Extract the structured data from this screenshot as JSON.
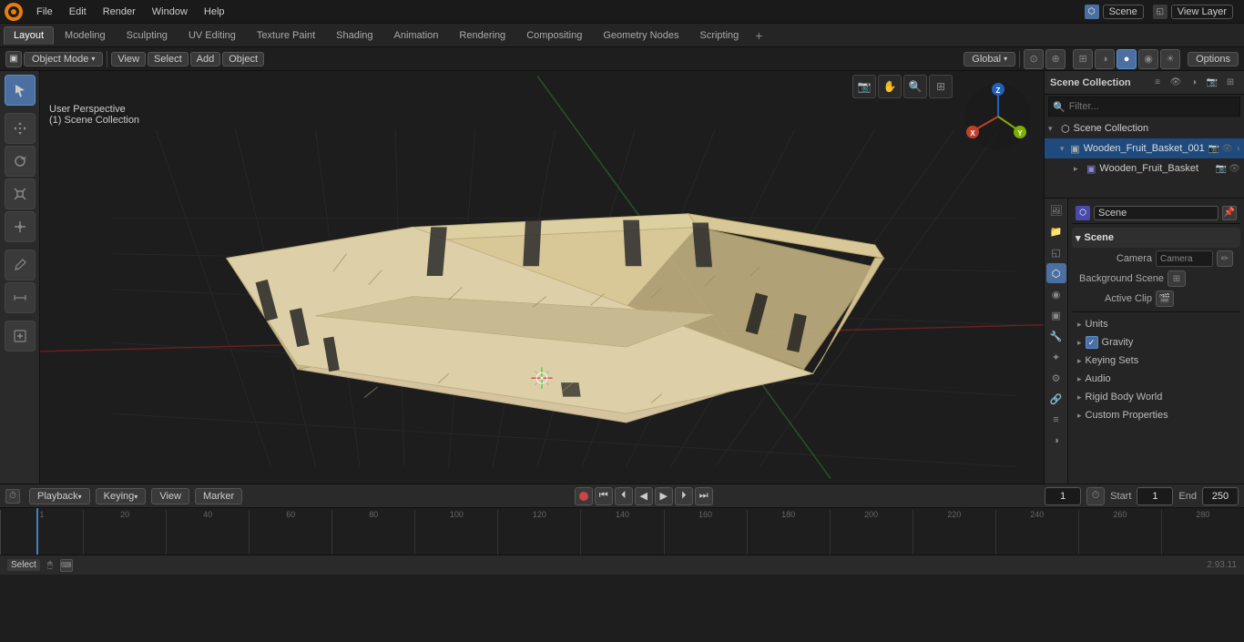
{
  "app": {
    "title": "Blender",
    "version": "2.93.11"
  },
  "top_menu": {
    "items": [
      "File",
      "Edit",
      "Render",
      "Window",
      "Help"
    ]
  },
  "workspace_tabs": {
    "active": "Layout",
    "items": [
      "Layout",
      "Modeling",
      "Sculpting",
      "UV Editing",
      "Texture Paint",
      "Shading",
      "Animation",
      "Rendering",
      "Compositing",
      "Geometry Nodes",
      "Scripting"
    ]
  },
  "header_bar": {
    "mode": "Object Mode",
    "viewport_shading": "Global",
    "options_label": "Options"
  },
  "viewport": {
    "info_line1": "User Perspective",
    "info_line2": "(1) Scene Collection",
    "view_label": "View",
    "select_label": "Select",
    "add_label": "Add",
    "object_label": "Object"
  },
  "outliner": {
    "title": "Scene Collection",
    "search_placeholder": "Filter...",
    "items": [
      {
        "name": "Scene Collection",
        "expanded": true,
        "level": 0,
        "icon": "scene"
      },
      {
        "name": "Wooden_Fruit_Basket_001",
        "expanded": true,
        "level": 1,
        "icon": "mesh",
        "selected": true
      },
      {
        "name": "Wooden_Fruit_Basket",
        "expanded": false,
        "level": 2,
        "icon": "mesh"
      }
    ]
  },
  "properties": {
    "scene_name": "Scene",
    "sections": {
      "scene_header": "Scene",
      "camera_label": "Camera",
      "background_scene_label": "Background Scene",
      "active_clip_label": "Active Clip",
      "units_label": "Units",
      "gravity_label": "Gravity",
      "gravity_checked": true,
      "keying_sets_label": "Keying Sets",
      "audio_label": "Audio",
      "rigid_body_world_label": "Rigid Body World",
      "custom_properties_label": "Custom Properties"
    }
  },
  "timeline": {
    "playback_label": "Playback",
    "keying_label": "Keying",
    "view_label": "View",
    "marker_label": "Marker",
    "current_frame": "1",
    "start_label": "Start",
    "start_value": "1",
    "end_label": "End",
    "end_value": "250",
    "ruler_marks": [
      "",
      "20",
      "40",
      "60",
      "80",
      "100",
      "120",
      "140",
      "160",
      "180",
      "200",
      "220",
      "240",
      "260",
      "280"
    ]
  },
  "status_bar": {
    "select_label": "Select",
    "version": "2.93.11"
  },
  "icons": {
    "expand_open": "▾",
    "expand_closed": "▸",
    "scene_icon": "⬡",
    "mesh_icon": "▣",
    "camera_icon": "📷",
    "render_icon": "🖼",
    "output_icon": "📁",
    "view_layer_icon": "◱",
    "scene_prop_icon": "⬡",
    "world_icon": "◉",
    "object_icon": "▣",
    "modifier_icon": "🔧",
    "particles_icon": "✦",
    "physics_icon": "⚙",
    "constraints_icon": "🔗",
    "data_icon": "≡",
    "material_icon": "◑",
    "check": "✓",
    "arrow_down": "▾",
    "arrow_right": "▸",
    "dot": "●",
    "plus": "+",
    "minus": "-",
    "eye": "👁",
    "camera_small": "📷",
    "filter": "≡"
  },
  "colors": {
    "accent_blue": "#4a6fa0",
    "active_tab": "#3d3d3d",
    "selected_item": "#1e4a7e",
    "panel_bg": "#252525",
    "toolbar_bg": "#2a2a2a",
    "viewport_bg": "#1d1d1d",
    "grid_color": "#2a2a2a",
    "axis_x": "#c0402a",
    "axis_y": "#7fad00",
    "axis_z": "#2060c0"
  }
}
